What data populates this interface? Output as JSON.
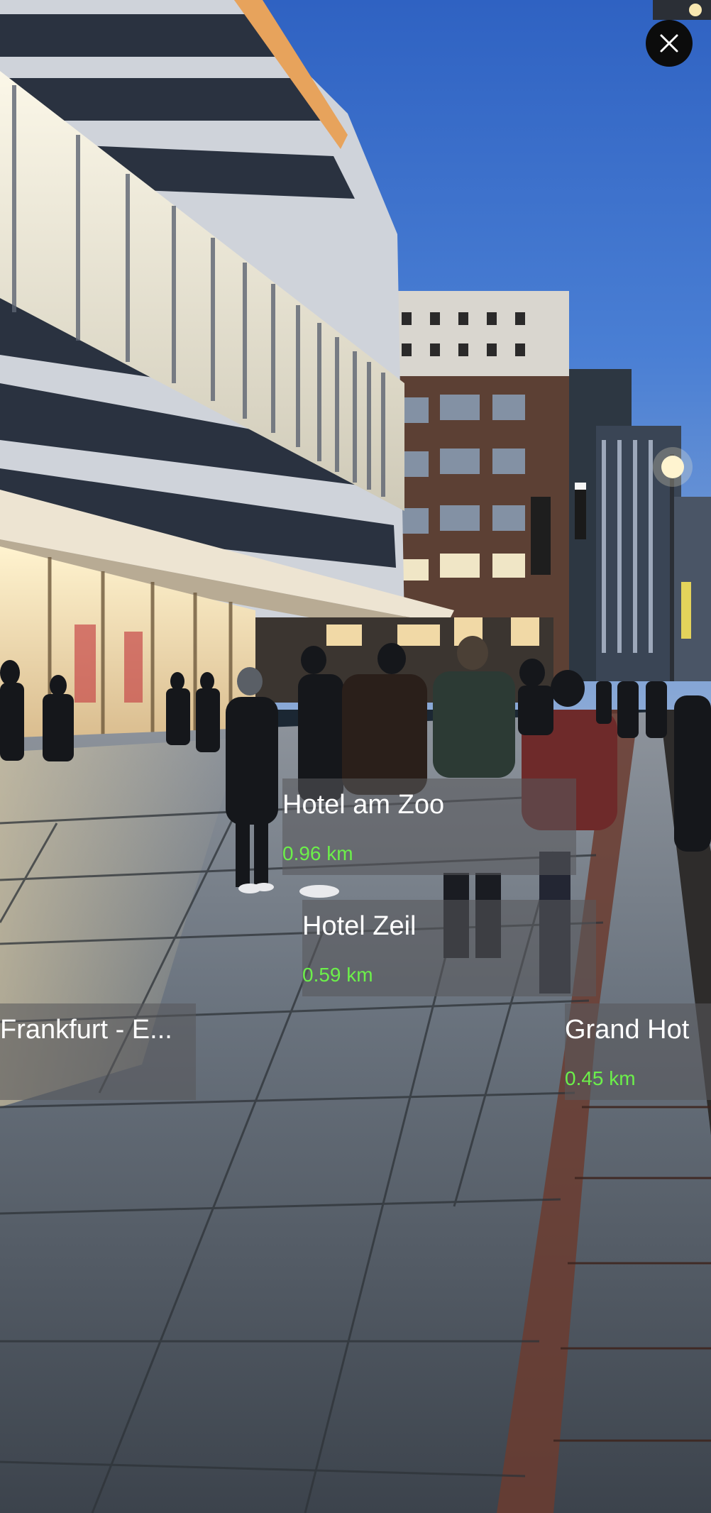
{
  "ar_view": {
    "labels": [
      {
        "name": "Hotel am Zoo",
        "distance": "0.96 km"
      },
      {
        "name": "Hotel Zeil",
        "distance": "0.59 km"
      },
      {
        "name": "Frankfurt - E...",
        "distance": ""
      },
      {
        "name": "Grand Hot",
        "distance": "0.45 km"
      }
    ]
  },
  "close_button": {
    "icon": "close-icon"
  },
  "colors": {
    "distance_text": "#6cf04a",
    "label_background": "rgba(88,88,92,0.58)",
    "label_text": "#ffffff",
    "close_button_background": "#0c0c0c"
  }
}
